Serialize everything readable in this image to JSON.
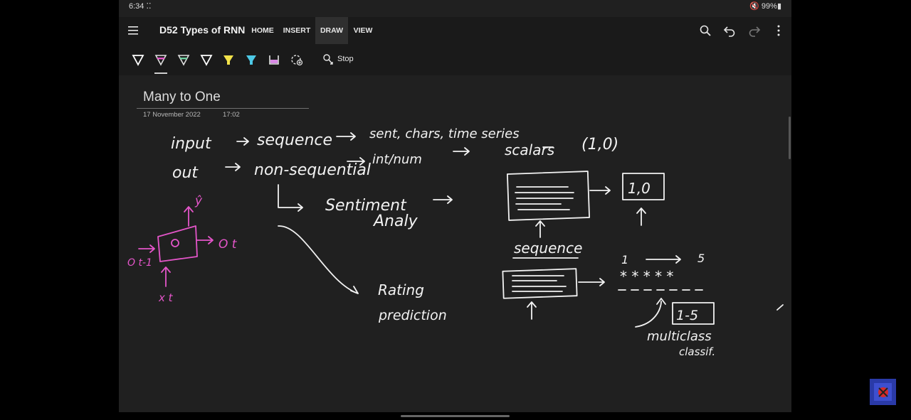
{
  "status": {
    "time": "6:34 ⁚⁚",
    "battery": "🔇 99%▮"
  },
  "header": {
    "title": "D52 Types of RNN",
    "tabs": [
      {
        "label": "HOME",
        "active": false
      },
      {
        "label": "INSERT",
        "active": false
      },
      {
        "label": "DRAW",
        "active": true
      },
      {
        "label": "VIEW",
        "active": false
      }
    ],
    "icons": [
      "menu-icon",
      "search-icon",
      "undo-icon",
      "redo-icon",
      "more-icon"
    ]
  },
  "draw_toolbar": {
    "pens": [
      {
        "name": "pen-white",
        "color": "#ffffff"
      },
      {
        "name": "pen-pink",
        "color": "#e455c9"
      },
      {
        "name": "pen-green",
        "color": "#6fd0a0"
      },
      {
        "name": "pen-white-2",
        "color": "#ffffff"
      },
      {
        "name": "highlighter-yellow",
        "color": "#f2e24a"
      },
      {
        "name": "highlighter-cyan",
        "color": "#4dc9e6"
      }
    ],
    "eraser": "eraser-icon",
    "add_pen": "add-pen-icon",
    "stop_label": "Stop"
  },
  "page": {
    "title": "Many to One",
    "date": "17 November 2022",
    "time": "17:02"
  },
  "handwriting": {
    "line1_input": "input",
    "line1_sequence": "sequence",
    "line1_tail": "sent, chars, time series",
    "line2_out": "out",
    "line2_nonseq": "non-sequential",
    "line2_int": "int/num",
    "line2_scalars": "scalars",
    "line2_val": "(1,0)",
    "sentiment": "Sentiment",
    "analy": "Analy",
    "box_label": "1,0",
    "sequence": "sequence",
    "rating": "Rating",
    "prediction": "prediction",
    "scale_1": "1",
    "scale_5": "5",
    "stars": "* * * * *",
    "range": "1-5",
    "multiclass": "multiclass",
    "classif": "classif.",
    "y_hat": "ŷ",
    "o_prev": "O t-1",
    "o_t": "O t",
    "x_t": "x t"
  },
  "colors": {
    "ink_white": "#f2f2f2",
    "ink_pink": "#e455c9",
    "canvas": "#202020",
    "toolbar": "#1a1a1a"
  }
}
